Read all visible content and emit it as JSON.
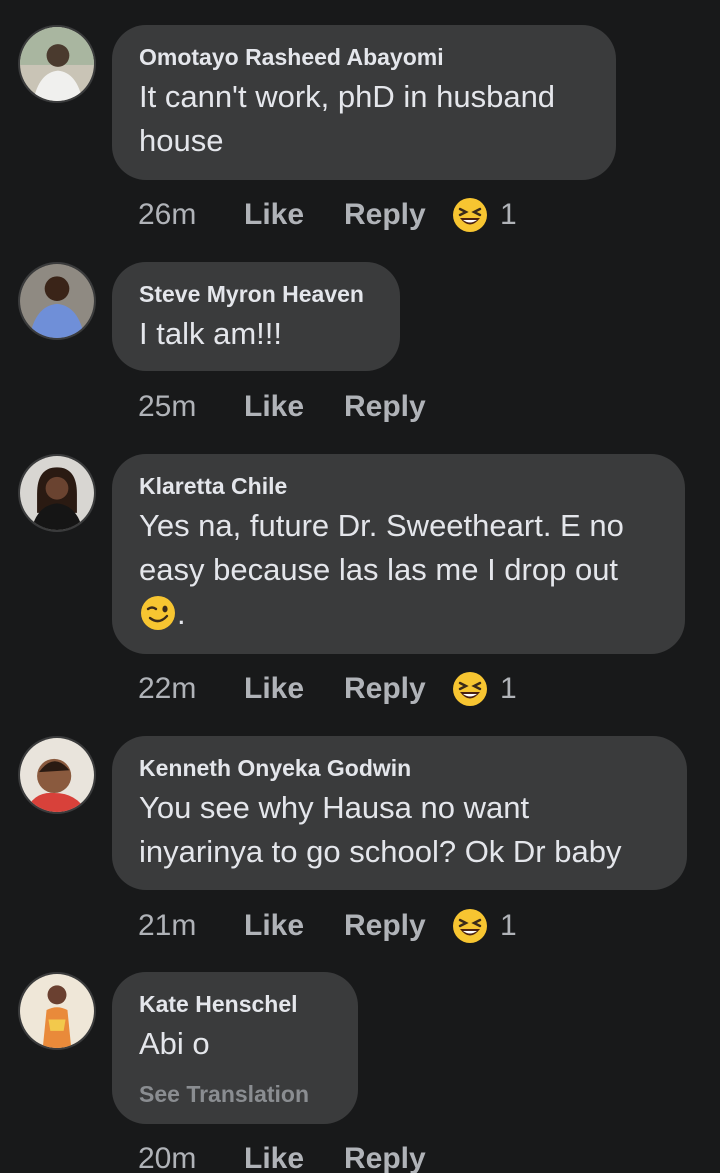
{
  "comments": [
    {
      "author": "Omotayo Rasheed Abayomi",
      "text": "It cann't work, phD in husband house",
      "time": "26m",
      "like": "Like",
      "reply": "Reply",
      "reaction_icon": "laughing-emoji-icon",
      "reaction_count": "1",
      "avatar": "profile-photo-icon"
    },
    {
      "author": "Steve Myron Heaven",
      "text": "I talk am!!!",
      "time": "25m",
      "like": "Like",
      "reply": "Reply",
      "avatar": "profile-photo-icon"
    },
    {
      "author": "Klaretta Chile",
      "text": "Yes na, future Dr. Sweetheart. E no easy because las las me I drop out",
      "text_suffix": ".",
      "inline_emoji": "winking-face-icon",
      "time": "22m",
      "like": "Like",
      "reply": "Reply",
      "reaction_icon": "laughing-emoji-icon",
      "reaction_count": "1",
      "avatar": "profile-photo-icon"
    },
    {
      "author": "Kenneth Onyeka Godwin",
      "text": "You see why Hausa no want inyarinya to go school? Ok Dr baby",
      "time": "21m",
      "like": "Like",
      "reply": "Reply",
      "reaction_icon": "laughing-emoji-icon",
      "reaction_count": "1",
      "avatar": "profile-photo-icon"
    },
    {
      "author": "Kate Henschel",
      "text": "Abi o",
      "see_translation": "See Translation",
      "time": "20m",
      "like": "Like",
      "reply": "Reply",
      "avatar": "profile-photo-icon"
    }
  ],
  "colors": {
    "background": "#18191a",
    "bubble": "#3a3b3c",
    "primary_text": "#e4e6eb",
    "secondary_text": "#b0b3b8",
    "emoji_yellow": "#f7c531"
  }
}
